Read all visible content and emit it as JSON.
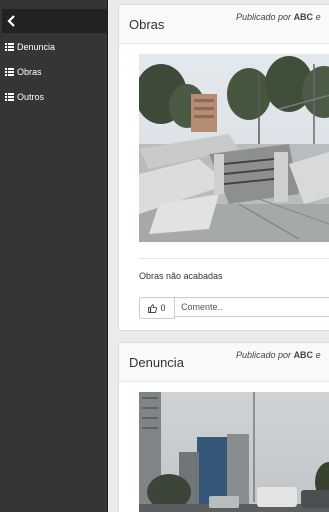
{
  "sidebar": {
    "back_icon": "chevron-left-icon",
    "items": [
      {
        "label": "Denuncia",
        "icon": "list-icon"
      },
      {
        "label": "Obras",
        "icon": "list-icon"
      },
      {
        "label": "Outros",
        "icon": "list-icon"
      }
    ]
  },
  "posts": [
    {
      "title": "Obras",
      "meta_prefix": "Publicado por",
      "author": "ABC",
      "meta_suffix": "e",
      "caption": "Obras não acabadas",
      "likes": "0",
      "comment_placeholder": "Comente.."
    },
    {
      "title": "Denuncia",
      "meta_prefix": "Publicado por",
      "author": "ABC",
      "meta_suffix": "e"
    }
  ],
  "colors": {
    "sidebar_bg": "#353535",
    "sidebar_top_bg": "#222222",
    "page_bg": "#e9ecef"
  }
}
